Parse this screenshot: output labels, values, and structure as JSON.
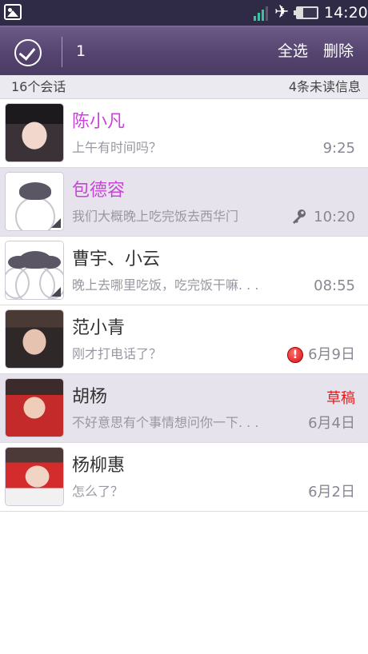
{
  "status_bar": {
    "time": "14:20",
    "icons": [
      "image-icon",
      "signal-icon",
      "airplane-icon",
      "battery-icon"
    ]
  },
  "action_bar": {
    "selected_count": "1",
    "select_all_label": "全选",
    "delete_label": "删除"
  },
  "summary": {
    "conversations": "16个会话",
    "unread": "4条未读信息"
  },
  "conversations": [
    {
      "name": "陈小凡",
      "snippet": "上午有时间吗？",
      "time": "9:25",
      "highlight": true,
      "selected": false,
      "avatar": "photo"
    },
    {
      "name": "包德容",
      "snippet": "我们大概晚上吃完饭去西华门",
      "time": "10:20",
      "highlight": true,
      "selected": true,
      "avatar": "default",
      "status_icon": "key-icon"
    },
    {
      "name": "曹宇、小云",
      "snippet": "晚上去哪里吃饭，吃完饭干嘛. . .",
      "time": "08:55",
      "highlight": false,
      "selected": false,
      "avatar": "group"
    },
    {
      "name": "范小青",
      "snippet": "刚才打电话了？",
      "time": "6月9日",
      "highlight": false,
      "selected": false,
      "avatar": "photo",
      "status_icon": "error-icon"
    },
    {
      "name": "胡杨",
      "snippet": "不好意思有个事情想问你一下. . .",
      "time": "6月4日",
      "draft": "草稿",
      "highlight": false,
      "selected": true,
      "avatar": "photo"
    },
    {
      "name": "杨柳惠",
      "snippet": " 怎么了？",
      "time": "6月2日",
      "highlight": false,
      "selected": false,
      "avatar": "photo"
    }
  ],
  "colors": {
    "status_bar": "#2f2a45",
    "action_bar": "#55446f",
    "highlight_name": "#c944d8",
    "draft": "#e21c1c",
    "selected_row": "#e6e3ec"
  }
}
